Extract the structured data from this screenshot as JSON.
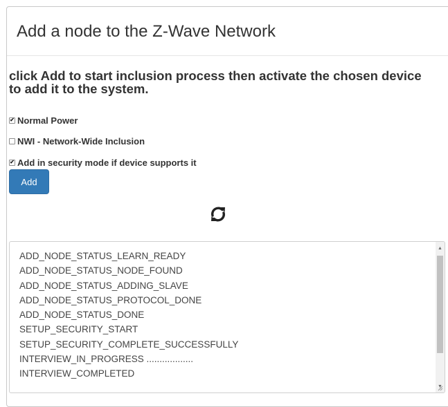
{
  "dialog": {
    "title": "Add a node to the Z-Wave Network",
    "instructions": "click Add to start inclusion process then activate the chosen device to add it to the system."
  },
  "options": [
    {
      "label": "Normal Power",
      "checked": true
    },
    {
      "label": "NWI - Network-Wide Inclusion",
      "checked": false
    },
    {
      "label": "Add in security mode if device supports it",
      "checked": true
    }
  ],
  "add_button": {
    "label": "Add"
  },
  "status_icon": "refresh-icon",
  "log": [
    "ADD_NODE_STATUS_LEARN_READY",
    "ADD_NODE_STATUS_NODE_FOUND",
    "ADD_NODE_STATUS_ADDING_SLAVE",
    "ADD_NODE_STATUS_PROTOCOL_DONE",
    "ADD_NODE_STATUS_DONE",
    "SETUP_SECURITY_START",
    "SETUP_SECURITY_COMPLETE_SUCCESSFULLY",
    "INTERVIEW_IN_PROGRESS ..................",
    "INTERVIEW_COMPLETED"
  ],
  "colors": {
    "primary": "#337ab7",
    "text": "#333333"
  }
}
